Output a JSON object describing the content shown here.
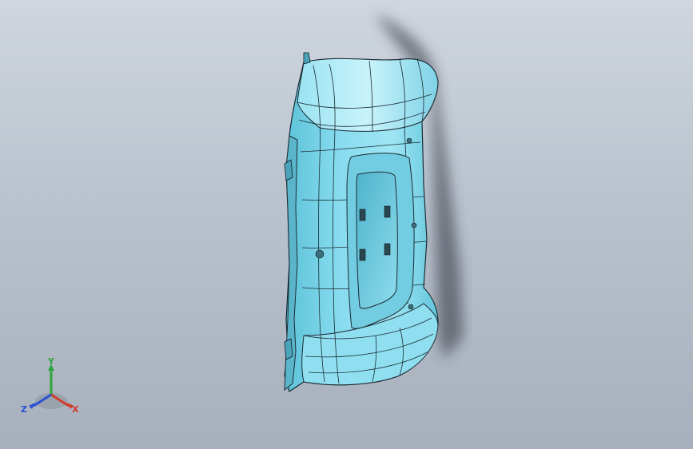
{
  "viewport": {
    "background_top": "#cfd6df",
    "background_bottom": "#a7b0bc"
  },
  "part": {
    "fill_color": "#7fd7ea",
    "highlight_color": "#bff0fa",
    "edge_color": "#1b2b33",
    "shadow_color": "#3a4048"
  },
  "triad": {
    "x_label": "X",
    "y_label": "Y",
    "z_label": "Z",
    "x_color": "#d23a2a",
    "y_color": "#2ea43a",
    "z_color": "#2a4fd2"
  }
}
